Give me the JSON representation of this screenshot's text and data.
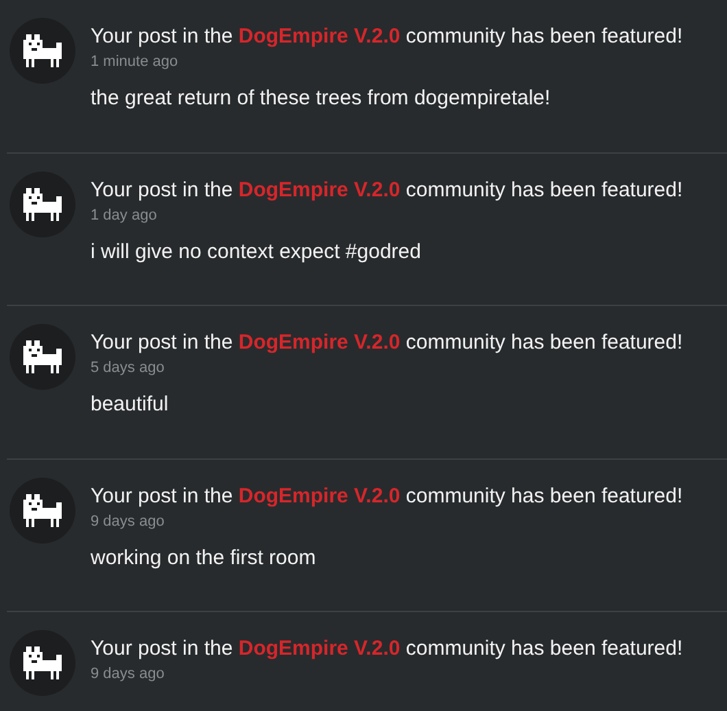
{
  "notifications": [
    {
      "prefix": "Your post in the",
      "community": "DogEmpire V.2.0",
      "suffix": "community has been featured!",
      "time": "1 minute ago",
      "body": "the great return of these trees from dogempiretale!"
    },
    {
      "prefix": "Your post in the",
      "community": "DogEmpire V.2.0",
      "suffix": "community has been featured!",
      "time": "1 day ago",
      "body": "i will give no context expect #godred"
    },
    {
      "prefix": "Your post in the",
      "community": "DogEmpire V.2.0",
      "suffix": "community has been featured!",
      "time": "5 days ago",
      "body": "beautiful"
    },
    {
      "prefix": "Your post in the",
      "community": "DogEmpire V.2.0",
      "suffix": "community has been featured!",
      "time": "9 days ago",
      "body": "working on the first room"
    },
    {
      "prefix": "Your post in the",
      "community": "DogEmpire V.2.0",
      "suffix": "community has been featured!",
      "time": "9 days ago"
    }
  ]
}
